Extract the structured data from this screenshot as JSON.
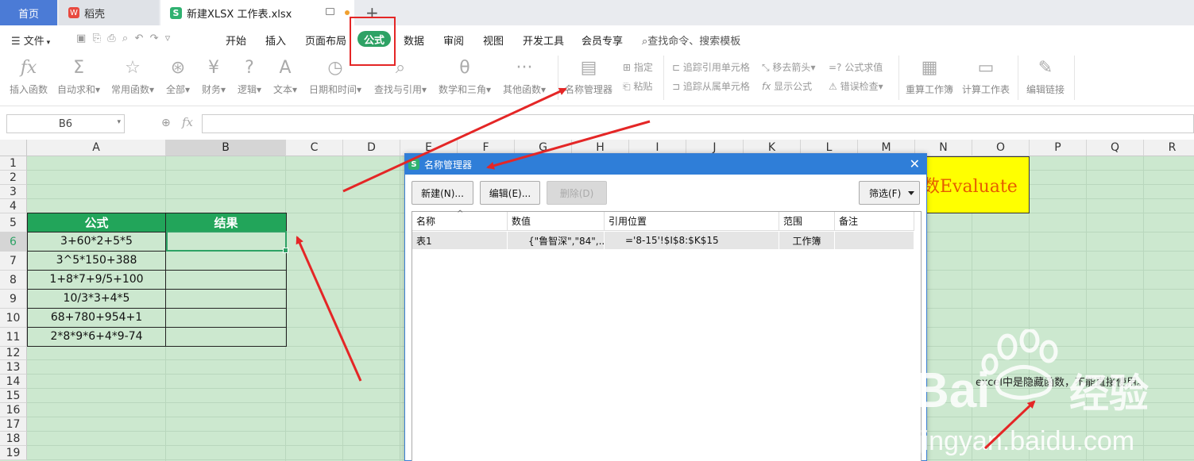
{
  "tabs": {
    "home": "首页",
    "wps": "稻壳",
    "file": "新建XLSX 工作表.xlsx",
    "plus": "+"
  },
  "menu": {
    "file": "文件",
    "items": [
      "开始",
      "插入",
      "页面布局",
      "公式",
      "数据",
      "审阅",
      "视图",
      "开发工具",
      "会员专享"
    ],
    "active": "公式",
    "search": "查找命令、搜索模板"
  },
  "toolbar": {
    "insert_fn": "插入函数",
    "autosum": "自动求和",
    "common_fn": "常用函数",
    "all": "全部",
    "finance": "财务",
    "logic": "逻辑",
    "text": "文本",
    "datetime": "日期和时间",
    "lookup": "查找与引用",
    "math": "数学和三角",
    "other_fn": "其他函数",
    "name_mgr": "名称管理器",
    "specify": "指定",
    "paste": "粘贴",
    "trace_prec": "追踪引用单元格",
    "trace_dep": "追踪从属单元格",
    "remove_arrows": "移去箭头",
    "show_formula": "显示公式",
    "eval_formula": "公式求值",
    "error_check": "错误检查",
    "recalc_wb": "重算工作簿",
    "calc_sheet": "计算工作表",
    "edit_links": "编辑链接"
  },
  "formula_bar": {
    "name_box": "B6",
    "fx": "fx",
    "value": ""
  },
  "sheet": {
    "columns": [
      "A",
      "B",
      "C",
      "D",
      "E",
      "F",
      "G",
      "H",
      "I",
      "J",
      "K",
      "L",
      "M",
      "N",
      "O",
      "P",
      "Q",
      "R"
    ],
    "rows": [
      "1",
      "2",
      "3",
      "4",
      "5",
      "6",
      "7",
      "8",
      "9",
      "10",
      "11",
      "12",
      "13",
      "14",
      "15",
      "16",
      "17",
      "18",
      "19"
    ],
    "table_header": [
      "公式",
      "结果"
    ],
    "formulas": [
      "3+60*2+5*5",
      "3^5*150+388",
      "1+8*7+9/5+100",
      "10/3*3+4*5",
      "68+780+954+1",
      "2*8*9*6+4*9-74"
    ],
    "yellow_text": "数Evaluate",
    "note": "excel中是隐藏函数，不能直接使用。"
  },
  "dialog": {
    "title": "名称管理器",
    "btn_new": "新建(N)...",
    "btn_edit": "编辑(E)...",
    "btn_delete": "删除(D)",
    "btn_filter": "筛选(F)",
    "columns": [
      "名称",
      "数值",
      "引用位置",
      "范围",
      "备注"
    ],
    "rows": [
      {
        "name": "表1",
        "value": "{\"鲁智深\",\"84\",...",
        "ref": "='8-15'!$I$8:$K$15",
        "scope": "工作簿",
        "note": ""
      }
    ]
  },
  "watermark": {
    "brand": "Bai",
    "brand2": "经验",
    "url": "jingyan.baidu.com"
  },
  "colors": {
    "accent": "#2ea265",
    "sheet_bg": "#cce8cf",
    "annotation": "#e42626",
    "dialog_title": "#2f7ed8"
  }
}
